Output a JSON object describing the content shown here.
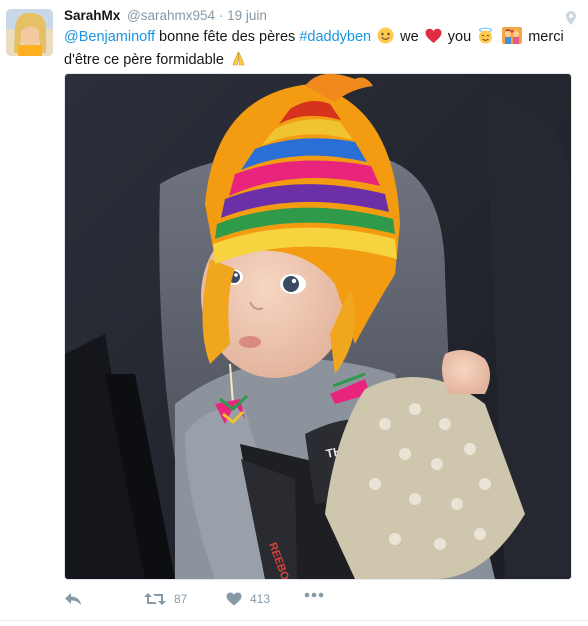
{
  "tweet": {
    "display_name": "SarahMx",
    "handle": "@sarahmx954",
    "separator": "·",
    "date": "19 juin",
    "text": {
      "mention": "@Benjaminoff",
      "part1": " bonne fête des pères ",
      "hashtag": "#daddyben",
      "part2": " we ",
      "part3": " you ",
      "part4": " merci",
      "line2": "d'être ce père formidable"
    },
    "media_text": {
      "seatbelt": "REEBOK",
      "shirt": "THE ROLLING"
    },
    "actions": {
      "retweets": "87",
      "likes": "413"
    }
  },
  "colors": {
    "link": "#1b95e0",
    "meta": "#8899a6"
  }
}
